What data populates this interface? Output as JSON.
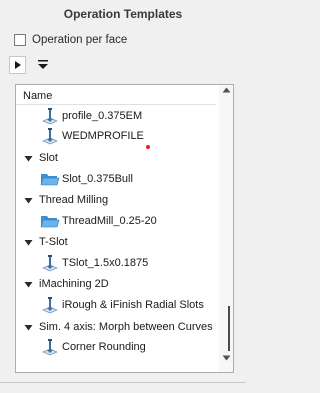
{
  "panel": {
    "title": "Operation Templates"
  },
  "options": {
    "per_face_label": "Operation per face",
    "per_face_checked": false
  },
  "tree": {
    "header": "Name",
    "rows": [
      {
        "kind": "item",
        "icon": "tool-operation-icon",
        "label": "profile_0.375EM"
      },
      {
        "kind": "item",
        "icon": "tool-operation-icon",
        "label": "WEDMPROFILE"
      },
      {
        "kind": "group",
        "label": "Slot"
      },
      {
        "kind": "item",
        "icon": "folder-icon",
        "label": "Slot_0.375Bull"
      },
      {
        "kind": "group",
        "label": "Thread Milling"
      },
      {
        "kind": "item",
        "icon": "folder-icon",
        "label": "ThreadMill_0.25-20"
      },
      {
        "kind": "group",
        "label": "T-Slot"
      },
      {
        "kind": "item",
        "icon": "tool-operation-icon",
        "label": "TSlot_1.5x0.1875"
      },
      {
        "kind": "group",
        "label": "iMachining 2D"
      },
      {
        "kind": "item",
        "icon": "tool-operation-icon",
        "label": "iRough & iFinish Radial Slots"
      },
      {
        "kind": "group",
        "label": "Sim. 4 axis: Morph between Curves"
      },
      {
        "kind": "item",
        "icon": "tool-operation-icon",
        "label": "Corner Rounding"
      }
    ]
  },
  "colors": {
    "folder": "#3a8fd6",
    "tool": "#3b6f9e",
    "marker": "#e8202a"
  }
}
